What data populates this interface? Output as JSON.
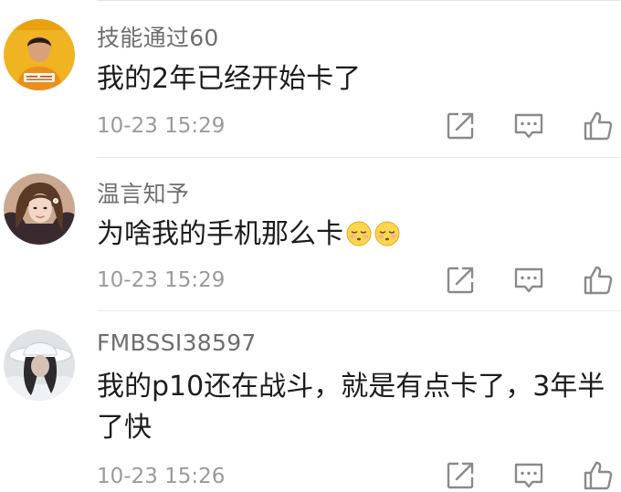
{
  "comments": [
    {
      "username": "技能通过60",
      "text": "我的2年已经开始卡了",
      "time": "10-23 15:29",
      "avatar_icon": "avatar-man-yellow-background"
    },
    {
      "username": "温言知予",
      "text": "为啥我的手机那么卡",
      "time": "10-23 15:29",
      "avatar_icon": "avatar-woman-portrait",
      "emoji_icon": "pensive-face-emoji"
    },
    {
      "username": "FMBSSI38597",
      "text": "我的p10还在战斗，就是有点卡了，3年半了快",
      "time": "10-23 15:26",
      "avatar_icon": "avatar-person-white-hat"
    }
  ],
  "action_icons": [
    "share-icon",
    "comment-icon",
    "like-icon"
  ],
  "colors": {
    "username": "#6e6e6e",
    "text": "#1c1c1c",
    "time": "#9a9a9a",
    "icon": "#8a8a8a",
    "divider": "#e6e6e6"
  }
}
